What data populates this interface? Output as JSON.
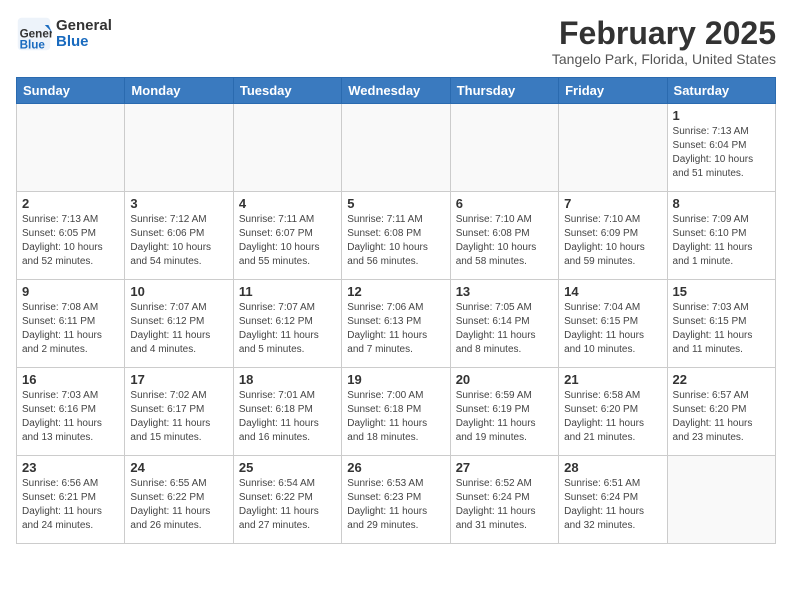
{
  "header": {
    "logo_general": "General",
    "logo_blue": "Blue",
    "main_title": "February 2025",
    "subtitle": "Tangelo Park, Florida, United States"
  },
  "days_of_week": [
    "Sunday",
    "Monday",
    "Tuesday",
    "Wednesday",
    "Thursday",
    "Friday",
    "Saturday"
  ],
  "weeks": [
    [
      {
        "day": "",
        "info": ""
      },
      {
        "day": "",
        "info": ""
      },
      {
        "day": "",
        "info": ""
      },
      {
        "day": "",
        "info": ""
      },
      {
        "day": "",
        "info": ""
      },
      {
        "day": "",
        "info": ""
      },
      {
        "day": "1",
        "info": "Sunrise: 7:13 AM\nSunset: 6:04 PM\nDaylight: 10 hours and 51 minutes."
      }
    ],
    [
      {
        "day": "2",
        "info": "Sunrise: 7:13 AM\nSunset: 6:05 PM\nDaylight: 10 hours and 52 minutes."
      },
      {
        "day": "3",
        "info": "Sunrise: 7:12 AM\nSunset: 6:06 PM\nDaylight: 10 hours and 54 minutes."
      },
      {
        "day": "4",
        "info": "Sunrise: 7:11 AM\nSunset: 6:07 PM\nDaylight: 10 hours and 55 minutes."
      },
      {
        "day": "5",
        "info": "Sunrise: 7:11 AM\nSunset: 6:08 PM\nDaylight: 10 hours and 56 minutes."
      },
      {
        "day": "6",
        "info": "Sunrise: 7:10 AM\nSunset: 6:08 PM\nDaylight: 10 hours and 58 minutes."
      },
      {
        "day": "7",
        "info": "Sunrise: 7:10 AM\nSunset: 6:09 PM\nDaylight: 10 hours and 59 minutes."
      },
      {
        "day": "8",
        "info": "Sunrise: 7:09 AM\nSunset: 6:10 PM\nDaylight: 11 hours and 1 minute."
      }
    ],
    [
      {
        "day": "9",
        "info": "Sunrise: 7:08 AM\nSunset: 6:11 PM\nDaylight: 11 hours and 2 minutes."
      },
      {
        "day": "10",
        "info": "Sunrise: 7:07 AM\nSunset: 6:12 PM\nDaylight: 11 hours and 4 minutes."
      },
      {
        "day": "11",
        "info": "Sunrise: 7:07 AM\nSunset: 6:12 PM\nDaylight: 11 hours and 5 minutes."
      },
      {
        "day": "12",
        "info": "Sunrise: 7:06 AM\nSunset: 6:13 PM\nDaylight: 11 hours and 7 minutes."
      },
      {
        "day": "13",
        "info": "Sunrise: 7:05 AM\nSunset: 6:14 PM\nDaylight: 11 hours and 8 minutes."
      },
      {
        "day": "14",
        "info": "Sunrise: 7:04 AM\nSunset: 6:15 PM\nDaylight: 11 hours and 10 minutes."
      },
      {
        "day": "15",
        "info": "Sunrise: 7:03 AM\nSunset: 6:15 PM\nDaylight: 11 hours and 11 minutes."
      }
    ],
    [
      {
        "day": "16",
        "info": "Sunrise: 7:03 AM\nSunset: 6:16 PM\nDaylight: 11 hours and 13 minutes."
      },
      {
        "day": "17",
        "info": "Sunrise: 7:02 AM\nSunset: 6:17 PM\nDaylight: 11 hours and 15 minutes."
      },
      {
        "day": "18",
        "info": "Sunrise: 7:01 AM\nSunset: 6:18 PM\nDaylight: 11 hours and 16 minutes."
      },
      {
        "day": "19",
        "info": "Sunrise: 7:00 AM\nSunset: 6:18 PM\nDaylight: 11 hours and 18 minutes."
      },
      {
        "day": "20",
        "info": "Sunrise: 6:59 AM\nSunset: 6:19 PM\nDaylight: 11 hours and 19 minutes."
      },
      {
        "day": "21",
        "info": "Sunrise: 6:58 AM\nSunset: 6:20 PM\nDaylight: 11 hours and 21 minutes."
      },
      {
        "day": "22",
        "info": "Sunrise: 6:57 AM\nSunset: 6:20 PM\nDaylight: 11 hours and 23 minutes."
      }
    ],
    [
      {
        "day": "23",
        "info": "Sunrise: 6:56 AM\nSunset: 6:21 PM\nDaylight: 11 hours and 24 minutes."
      },
      {
        "day": "24",
        "info": "Sunrise: 6:55 AM\nSunset: 6:22 PM\nDaylight: 11 hours and 26 minutes."
      },
      {
        "day": "25",
        "info": "Sunrise: 6:54 AM\nSunset: 6:22 PM\nDaylight: 11 hours and 27 minutes."
      },
      {
        "day": "26",
        "info": "Sunrise: 6:53 AM\nSunset: 6:23 PM\nDaylight: 11 hours and 29 minutes."
      },
      {
        "day": "27",
        "info": "Sunrise: 6:52 AM\nSunset: 6:24 PM\nDaylight: 11 hours and 31 minutes."
      },
      {
        "day": "28",
        "info": "Sunrise: 6:51 AM\nSunset: 6:24 PM\nDaylight: 11 hours and 32 minutes."
      },
      {
        "day": "",
        "info": ""
      }
    ]
  ]
}
